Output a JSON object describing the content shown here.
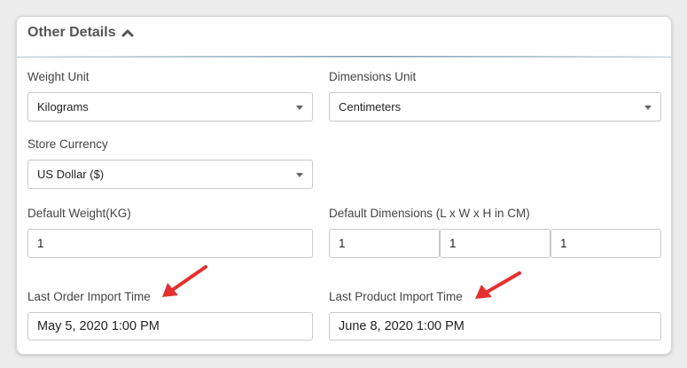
{
  "section": {
    "title": "Other Details",
    "toggle_icon": "chevron-up-icon"
  },
  "fields": {
    "weight_unit": {
      "label": "Weight Unit",
      "value": "Kilograms"
    },
    "dimensions_unit": {
      "label": "Dimensions Unit",
      "value": "Centimeters"
    },
    "store_currency": {
      "label": "Store Currency",
      "value": "US Dollar ($)"
    },
    "default_weight": {
      "label": "Default Weight(KG)",
      "value": "1"
    },
    "default_dimensions": {
      "label": "Default Dimensions (L x W x H in CM)",
      "length": "1",
      "width": "1",
      "height": "1"
    },
    "last_order_import": {
      "label": "Last Order Import Time",
      "value": "May 5, 2020 1:00 PM"
    },
    "last_product_import": {
      "label": "Last Product Import Time",
      "value": "June 8, 2020 1:00 PM"
    }
  },
  "annotations": {
    "arrow_color": "#e3302f"
  }
}
